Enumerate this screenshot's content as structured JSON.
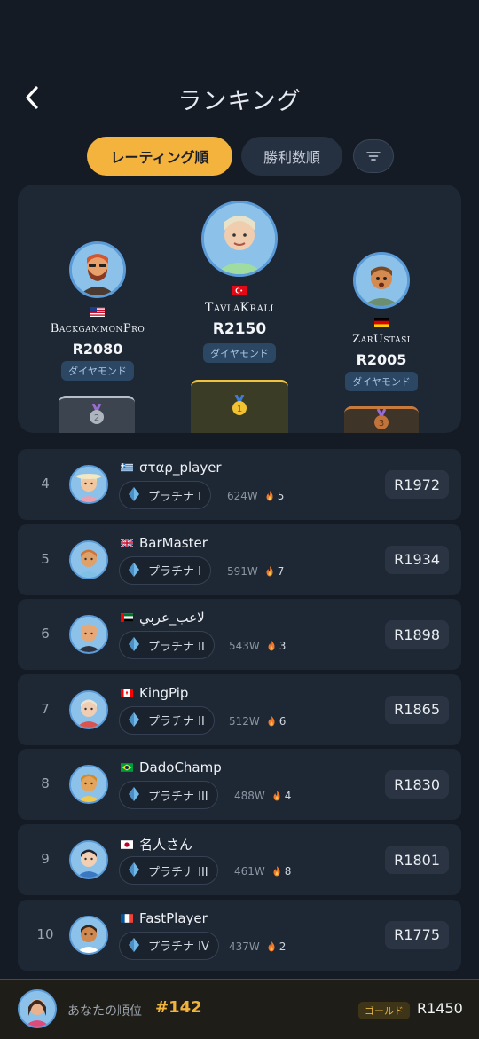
{
  "header": {
    "title": "ランキング"
  },
  "tabs": [
    {
      "label": "レーティング順",
      "active": true
    },
    {
      "label": "勝利数順",
      "active": false
    }
  ],
  "podium": [
    {
      "place": 2,
      "name": "BackgammonPro",
      "rating": "R2080",
      "tier": "ダイヤモンド",
      "flag": "us",
      "medal": "2"
    },
    {
      "place": 1,
      "name": "TavlaKrali",
      "rating": "R2150",
      "tier": "ダイヤモンド",
      "flag": "tr",
      "medal": "1"
    },
    {
      "place": 3,
      "name": "ZarUstasi",
      "rating": "R2005",
      "tier": "ダイヤモンド",
      "flag": "de",
      "medal": "3"
    }
  ],
  "rows": [
    {
      "rank": "4",
      "name": "σταρ_player",
      "flag": "gr",
      "tier": "プラチナ I",
      "wins": "624W",
      "streak": "5",
      "rating": "R1972"
    },
    {
      "rank": "5",
      "name": "BarMaster",
      "flag": "gb",
      "tier": "プラチナ I",
      "wins": "591W",
      "streak": "7",
      "rating": "R1934"
    },
    {
      "rank": "6",
      "name": "لاعب_عربي",
      "flag": "ae",
      "tier": "プラチナ II",
      "wins": "543W",
      "streak": "3",
      "rating": "R1898"
    },
    {
      "rank": "7",
      "name": "KingPip",
      "flag": "ca",
      "tier": "プラチナ II",
      "wins": "512W",
      "streak": "6",
      "rating": "R1865"
    },
    {
      "rank": "8",
      "name": "DadoChamp",
      "flag": "br",
      "tier": "プラチナ III",
      "wins": "488W",
      "streak": "4",
      "rating": "R1830"
    },
    {
      "rank": "9",
      "name": "名人さん",
      "flag": "jp",
      "tier": "プラチナ III",
      "wins": "461W",
      "streak": "8",
      "rating": "R1801"
    },
    {
      "rank": "10",
      "name": "FastPlayer",
      "flag": "fr",
      "tier": "プラチナ IV",
      "wins": "437W",
      "streak": "2",
      "rating": "R1775"
    }
  ],
  "footer": {
    "label": "あなたの順位",
    "rank": "#142",
    "tier": "ゴールド",
    "rating": "R1450"
  },
  "colors": {
    "accent": "#f3b33d",
    "background": "#141b25",
    "card": "#1e2734",
    "avatar_ring": "#5a9bd8"
  }
}
